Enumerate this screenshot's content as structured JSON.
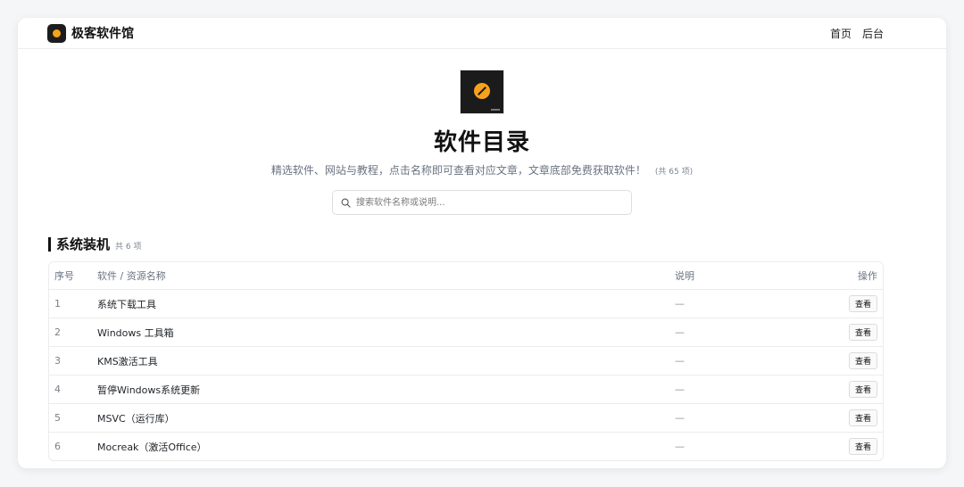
{
  "header": {
    "brand": "极客软件馆",
    "nav": [
      "首页",
      "后台"
    ]
  },
  "hero": {
    "title": "软件目录",
    "subtitle": "精选软件、网站与教程，点击名称即可查看对应文章，文章底部免费获取软件！",
    "total": "(共 65 项)"
  },
  "search": {
    "placeholder": "搜索软件名称或说明..."
  },
  "section": {
    "title": "系统装机",
    "count": "共 6 项",
    "columns": [
      "序号",
      "软件 / 资源名称",
      "说明",
      "操作"
    ],
    "rows": [
      {
        "idx": "1",
        "name": "系统下载工具",
        "desc": "—",
        "action": "查看"
      },
      {
        "idx": "2",
        "name": "Windows 工具箱",
        "desc": "—",
        "action": "查看"
      },
      {
        "idx": "3",
        "name": "KMS激活工具",
        "desc": "—",
        "action": "查看"
      },
      {
        "idx": "4",
        "name": "暂停Windows系统更新",
        "desc": "—",
        "action": "查看"
      },
      {
        "idx": "5",
        "name": "MSVC（运行库）",
        "desc": "—",
        "action": "查看"
      },
      {
        "idx": "6",
        "name": "Mocreak（激活Office）",
        "desc": "—",
        "action": "查看"
      }
    ]
  },
  "colors": {
    "accent": "#f6a21c",
    "logo_bg": "#1c1c1c"
  },
  "icons": {
    "search": "search-icon",
    "logo": "logo-icon"
  }
}
